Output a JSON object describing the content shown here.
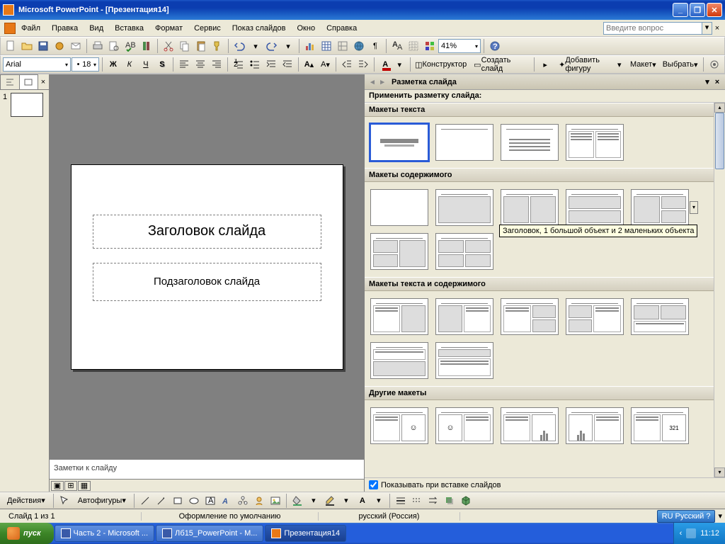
{
  "title": "Microsoft PowerPoint - [Презентация14]",
  "menu": [
    "Файл",
    "Правка",
    "Вид",
    "Вставка",
    "Формат",
    "Сервис",
    "Показ слайдов",
    "Окно",
    "Справка"
  ],
  "question_placeholder": "Введите вопрос",
  "fmt": {
    "font": "Arial",
    "size": "18",
    "zoom": "41%",
    "designer": "Конструктор",
    "newslide": "Создать слайд",
    "addshape": "Добавить фигуру",
    "layout": "Макет",
    "select": "Выбрать"
  },
  "thumb_num": "1",
  "slide": {
    "title": "Заголовок слайда",
    "subtitle": "Подзаголовок слайда"
  },
  "notes": "Заметки к слайду",
  "task": {
    "title": "Разметка слайда",
    "apply": "Применить разметку слайда:",
    "sec_text": "Макеты текста",
    "sec_content": "Макеты содержимого",
    "sec_textcontent": "Макеты текста и содержимого",
    "sec_other": "Другие макеты",
    "show_insert": "Показывать при вставке слайдов",
    "tooltip": "Заголовок, 1 большой объект и 2 маленьких объекта"
  },
  "draw": {
    "actions": "Действия",
    "autoshapes": "Автофигуры"
  },
  "status": {
    "slide": "Слайд 1 из 1",
    "design": "Оформление по умолчанию",
    "lang": "русский (Россия)",
    "ind_short": "RU",
    "ind_lang": "Русский"
  },
  "taskbar": {
    "start": "пуск",
    "items": [
      "Часть 2 - Microsoft ...",
      "Лб15_PowerPoint - M...",
      "Презентация14"
    ],
    "clock": "11:12"
  }
}
